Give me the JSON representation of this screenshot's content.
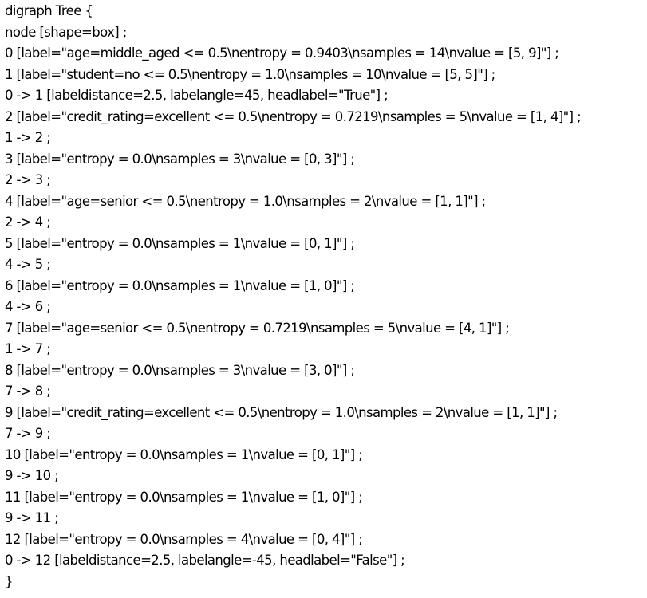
{
  "document": {
    "lines": [
      "digraph Tree {",
      "node [shape=box] ;",
      "0 [label=\"age=middle_aged <= 0.5\\nentropy = 0.9403\\nsamples = 14\\nvalue = [5, 9]\"] ;",
      "1 [label=\"student=no <= 0.5\\nentropy = 1.0\\nsamples = 10\\nvalue = [5, 5]\"] ;",
      "0 -> 1 [labeldistance=2.5, labelangle=45, headlabel=\"True\"] ;",
      "2 [label=\"credit_rating=excellent <= 0.5\\nentropy = 0.7219\\nsamples = 5\\nvalue = [1, 4]\"] ;",
      "1 -> 2 ;",
      "3 [label=\"entropy = 0.0\\nsamples = 3\\nvalue = [0, 3]\"] ;",
      "2 -> 3 ;",
      "4 [label=\"age=senior <= 0.5\\nentropy = 1.0\\nsamples = 2\\nvalue = [1, 1]\"] ;",
      "2 -> 4 ;",
      "5 [label=\"entropy = 0.0\\nsamples = 1\\nvalue = [0, 1]\"] ;",
      "4 -> 5 ;",
      "6 [label=\"entropy = 0.0\\nsamples = 1\\nvalue = [1, 0]\"] ;",
      "4 -> 6 ;",
      "7 [label=\"age=senior <= 0.5\\nentropy = 0.7219\\nsamples = 5\\nvalue = [4, 1]\"] ;",
      "1 -> 7 ;",
      "8 [label=\"entropy = 0.0\\nsamples = 3\\nvalue = [3, 0]\"] ;",
      "7 -> 8 ;",
      "9 [label=\"credit_rating=excellent <= 0.5\\nentropy = 1.0\\nsamples = 2\\nvalue = [1, 1]\"] ;",
      "7 -> 9 ;",
      "10 [label=\"entropy = 0.0\\nsamples = 1\\nvalue = [0, 1]\"] ;",
      "9 -> 10 ;",
      "11 [label=\"entropy = 0.0\\nsamples = 1\\nvalue = [1, 0]\"] ;",
      "9 -> 11 ;",
      "12 [label=\"entropy = 0.0\\nsamples = 4\\nvalue = [0, 4]\"] ;",
      "0 -> 12 [labeldistance=2.5, labelangle=-45, headlabel=\"False\"] ;",
      "}"
    ]
  }
}
